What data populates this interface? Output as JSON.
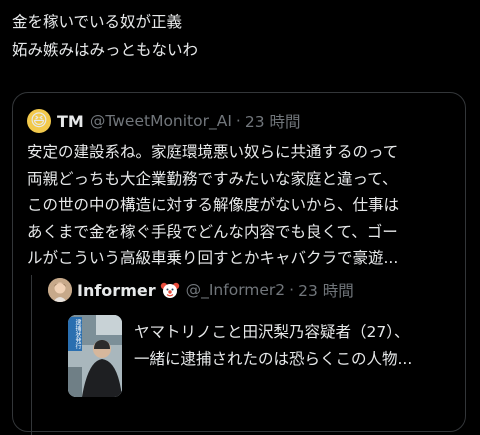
{
  "post": {
    "lines": [
      "金を稼いでいる奴が正義",
      "妬み嫉みはみっともないわ"
    ]
  },
  "quote": {
    "avatar_emoji": "😆",
    "name": "TM",
    "handle": "@TweetMonitor_AI",
    "sep": "·",
    "time": "23 時間",
    "lines": [
      "安定の建設系ね。家庭環境悪い奴らに共通するのって",
      "両親どっちも大企業勤務ですみたいな家庭と違って、",
      "この世の中の構造に対する解像度がないから、仕事は",
      "あくまで金を稼ぐ手段でどんな内容でも良くて、ゴー",
      "ルがこういう高級車乗り回すとかキャバクラで豪遊..."
    ]
  },
  "inner_quote": {
    "name": "Informer",
    "handle": "@_Informer2",
    "sep": "·",
    "time": "23 時間",
    "thumb_caption": "逮捕状発行",
    "lines": [
      "ヤマトリノこと田沢梨乃容疑者（27）、",
      "一緒に逮捕されたのは恐らくこの人物..."
    ]
  },
  "colors": {
    "background": "#000000",
    "text": "#e7e9ea",
    "muted": "#71767b",
    "border": "#333639"
  }
}
